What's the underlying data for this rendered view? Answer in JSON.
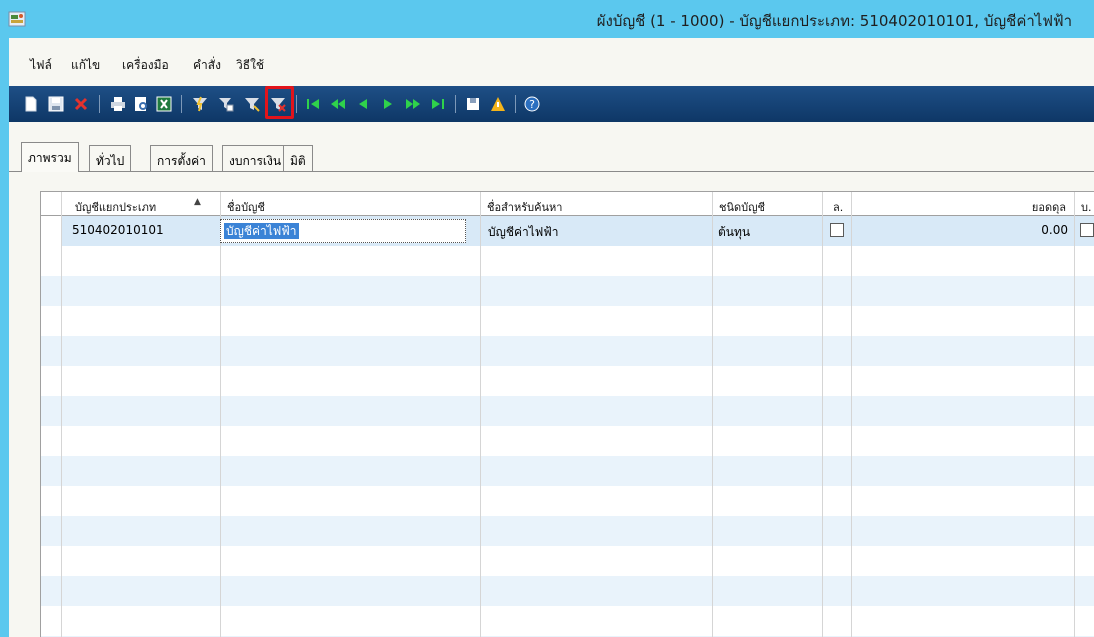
{
  "window": {
    "title": "ผังบัญชี (1 - 1000) - บัญชีแยกประเภท: 510402010101, บัญชีค่าไฟฟ้า",
    "titlebar_color": "#5bc8ee"
  },
  "menu": {
    "items": [
      "ไฟล์",
      "แก้ไข",
      "เครื่องมือ",
      "คำสั่ง",
      "วิธีใช้"
    ]
  },
  "toolbar": {
    "buttons": [
      "new-icon",
      "save-icon",
      "delete-icon",
      "print-icon",
      "print-preview-icon",
      "export-excel-icon",
      "filter-by-selection-icon",
      "filter-by-grid-icon",
      "advanced-filter-icon",
      "clear-filter-icon",
      "first-record-icon",
      "previous-page-icon",
      "previous-record-icon",
      "next-record-icon",
      "next-page-icon",
      "last-record-icon",
      "document-handling-icon",
      "alert-icon",
      "help-icon"
    ],
    "highlighted_button": "clear-filter-icon",
    "highlight_color": "#e2141b"
  },
  "tabs": {
    "items": [
      "ภาพรวม",
      "ทั่วไป",
      "การตั้งค่า",
      "งบการเงิน",
      "มิติ"
    ],
    "active": "ภาพรวม"
  },
  "grid": {
    "columns": [
      "บัญชีแยกประเภท",
      "ชื่อบัญชี",
      "ชื่อสำหรับค้นหา",
      "ชนิดบัญชี",
      "ล.",
      "ยอดดุล",
      "บ."
    ],
    "sort_indicator": "▲",
    "rows": [
      {
        "ledger_account": "510402010101",
        "account_name": "บัญชีค่าไฟฟ้า",
        "search_name": "บัญชีค่าไฟฟ้า",
        "account_type": "ต้นทุน",
        "locked": false,
        "balance": "0.00",
        "flag": false
      }
    ]
  }
}
